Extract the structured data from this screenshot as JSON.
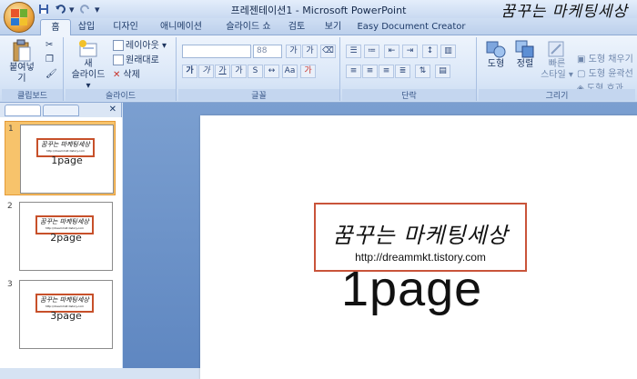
{
  "window": {
    "title": "프레젠테이션1 - Microsoft PowerPoint"
  },
  "quick_access": {
    "save_icon": "save-icon",
    "undo_icon": "undo-icon",
    "redo_icon": "redo-icon"
  },
  "brand": {
    "name": "꿈꾸는 마케팅세상",
    "url": "http://dreammkt.tistory.com"
  },
  "tabs": [
    {
      "label": "홈",
      "active": true
    },
    {
      "label": "삽입"
    },
    {
      "label": "디자인"
    },
    {
      "label": "애니메이션"
    },
    {
      "label": "슬라이드 쇼"
    },
    {
      "label": "검토"
    },
    {
      "label": "보기"
    },
    {
      "label": "Easy Document Creator"
    }
  ],
  "ribbon": {
    "clipboard": {
      "paste": "붙여넣기",
      "label": "클립보드"
    },
    "slides": {
      "new_slide_1": "새",
      "new_slide_2": "슬라이드 ▾",
      "layout": "레이아웃 ▾",
      "reset": "원래대로",
      "delete": "삭제",
      "label": "슬라이드"
    },
    "font": {
      "font_name": "",
      "font_size": "88",
      "label": "글꼴"
    },
    "paragraph": {
      "label": "단락"
    },
    "drawing": {
      "shape": "도형",
      "arrange": "정렬",
      "quick_style_1": "빠른",
      "quick_style_2": "스타일 ▾",
      "fill": "도형 채우기",
      "outline": "도형 윤곽선",
      "effect": "도형 효과",
      "label": "그리기"
    }
  },
  "thumbnails": [
    {
      "num": "1",
      "page": "1page",
      "selected": true
    },
    {
      "num": "2",
      "page": "2page"
    },
    {
      "num": "3",
      "page": "3page"
    }
  ],
  "slide": {
    "page_label": "1page"
  },
  "colors": {
    "ribbon": "#dce8f8",
    "accent_border": "#c9543a",
    "selected_thumb": "#f7c36b",
    "workspace": "#6d93c8"
  }
}
